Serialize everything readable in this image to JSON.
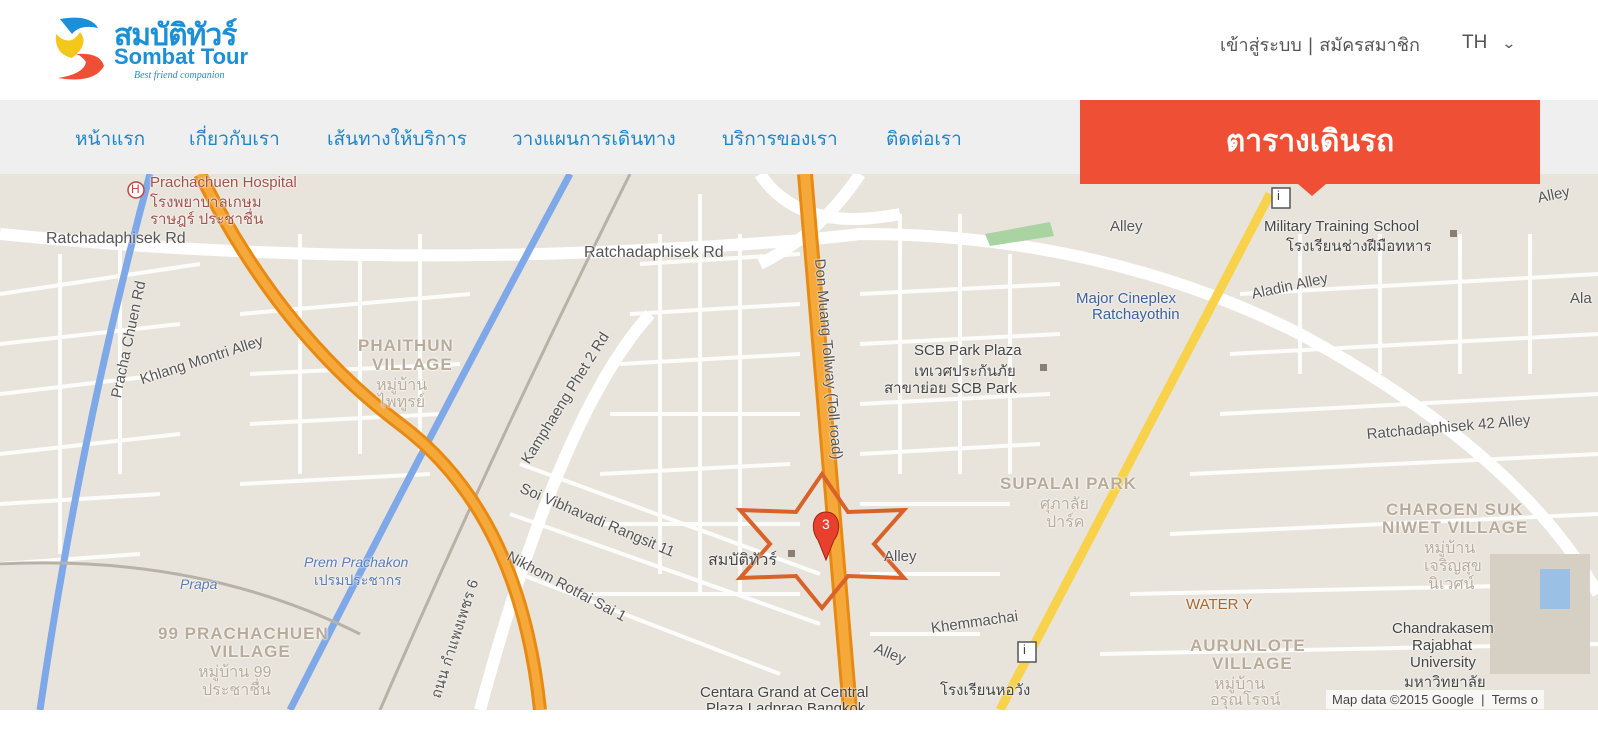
{
  "brand": {
    "name_th": "สมบัติทัวร์",
    "name_en": "Sombat Tour",
    "tagline": "Best friend companion"
  },
  "header": {
    "auth_links": "เข้าสู่ระบบ | สมัครสมาชิก",
    "language": "TH"
  },
  "nav": {
    "items": [
      "หน้าแรก",
      "เกี่ยวกับเรา",
      "เส้นทางให้บริการ",
      "วางแผนการเดินทาง",
      "บริการของเรา",
      "ติดต่อเรา"
    ],
    "schedule_button": "ตารางเดินรถ"
  },
  "map": {
    "marker_label": "3",
    "place_label": "สมบัติทัวร์",
    "attribution": "Map data ©2015 Google",
    "terms": "Terms o",
    "labels": {
      "hospital_en": "Prachachuen Hospital",
      "hospital_th1": "โรงพยาบาลเกษม",
      "hospital_th2": "ราษฎร์ ประชาชื่น",
      "ratcha_rd_left": "Ratchadaphisek Rd",
      "ratcha_rd_mid": "Ratchadaphisek Rd",
      "pracha_chuen_rd": "Pracha Chuen Rd",
      "khlang_montri": "Khlang Montri Alley",
      "phaithun_village": "PHAITHUN",
      "phaithun_village2": "VILLAGE",
      "phaithun_th1": "หมู่บ้าน",
      "phaithun_th2": "ไพทูรย์",
      "kamphaeng_phet": "Kamphaeng Phet 2 Rd",
      "don_muang_tollway": "Don Muang Tollway (Toll road)",
      "soi_vibhavadi": "Soi Vibhavadi Rangsit 11",
      "nikhom_rotfai": "Nikhom Rotfai Sai 1",
      "prem_prachakon": "Prem Prachakon",
      "prem_prachakon_th": "เปรมประชากร",
      "prapa": "Prapa",
      "village_99": "99 PRACHACHUEN",
      "village_99b": "VILLAGE",
      "village_99_th1": "หมู่บ้าน 99",
      "village_99_th2": "ประชาชื่น",
      "kamphaeng_th": "ถนน กำแพงเพชร 6",
      "alley_top": "Alley",
      "alley_mid": "Alley",
      "alley_low": "Alley",
      "military_school": "Military Training School",
      "military_school_th": "โรงเรียนช่างฝีมือทหาร",
      "aladin_alley": "Aladin Alley",
      "major_cineplex": "Major Cineplex",
      "major_cineplex2": "Ratchayothin",
      "scb_plaza": "SCB Park Plaza",
      "scb_plaza_th": "เทเวศประกันภัย",
      "scb_plaza_th2": "สาขาย่อย SCB Park",
      "ratcha_42": "Ratchadaphisek 42 Alley",
      "supalai_park": "SUPALAI PARK",
      "supalai_th1": "ศุภาลัย",
      "supalai_th2": "ปาร์ค",
      "charoen_suk": "CHAROEN SUK",
      "niwet_village": "NIWET VILLAGE",
      "charoen_th1": "หมู่บ้าน",
      "charoen_th2": "เจริญสุข",
      "charoen_th3": "นิเวศน์",
      "water_y": "WATER Y",
      "khemmachai": "Khemmachai",
      "aurunlote": "AURUNLOTE",
      "aurunlote2": "VILLAGE",
      "aurunlote_th1": "หมู่บ้าน",
      "aurunlote_th2": "อรุณโรจน์",
      "chandrakasem": "Chandrakasem",
      "chandrakasem2": "Rajabhat",
      "chandrakasem3": "University",
      "chandrakasem_th": "มหาวิทยาลัย",
      "centara": "Centara Grand at Central",
      "centara2": "Plaza Ladprao Bangkok",
      "school_th": "โรงเรียนหอวัง",
      "ala_edge": "Ala",
      "alley_edge": "Alley"
    }
  },
  "colors": {
    "accent": "#ef4f35",
    "nav_text": "#1f86c9",
    "map_bg": "#e8e4dc",
    "tollway": "#f39b1f",
    "highway": "#f7d24a",
    "rail": "#7fa8e8",
    "star": "#d8622a"
  }
}
